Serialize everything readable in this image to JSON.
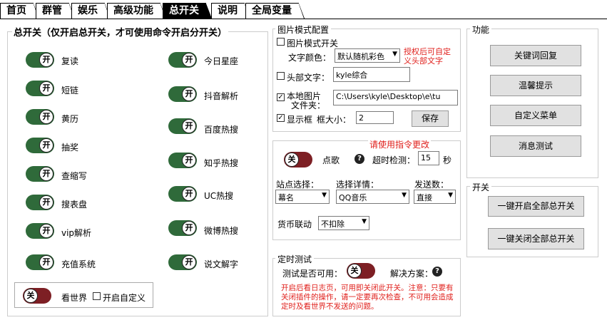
{
  "tabs": [
    "首页",
    "群管",
    "娱乐",
    "高级功能",
    "总开关",
    "说明",
    "全局变量"
  ],
  "master": {
    "title": "总开关（仅开启总开关，才可使用命令开启分开关）",
    "left_items": [
      "复读",
      "短链",
      "黄历",
      "抽奖",
      "查缩写",
      "搜表盘",
      "vip解析",
      "充值系统"
    ],
    "right_items": [
      "今日星座",
      "抖音解析",
      "百度热搜",
      "知乎热搜",
      "UC热搜",
      "微博热搜",
      "说文解字"
    ],
    "on_text": "开",
    "off_text": "关",
    "world_label": "看世界",
    "world_custom_label": "开启自定义"
  },
  "image_mode": {
    "title": "图片模式配置",
    "switch_label": "图片模式开关",
    "font_color_label": "文字颜色：",
    "font_color_value": "默认随机彩色",
    "note": "授权后可自定义头部文字",
    "header_text_label": "头部文字：",
    "header_text_value": "kyle综合",
    "local_image_label_1": "本地图片",
    "local_image_label_2": "文件夹：",
    "local_image_path": "C:\\Users\\kyle\\Desktop\\e\\tu",
    "show_frame_label": "显示框",
    "frame_size_label": "框大小：",
    "frame_size_value": "2",
    "save_label": "保存"
  },
  "song": {
    "note": "请使用指令更改",
    "label": "点歌",
    "timeout_label": "超时检测：",
    "timeout_value": "15",
    "timeout_unit": "秒",
    "site_label": "站点选择：",
    "site_value": "幕名",
    "detail_label": "选择详情：",
    "detail_value": "QQ音乐",
    "send_label": "发送数：",
    "send_value": "直接",
    "currency_label": "货币联动",
    "currency_value": "不扣除"
  },
  "timer": {
    "title": "定时测试",
    "test_label": "测试是否可用：",
    "solution_label": "解决方案：",
    "warning": "开启后看日志页，可用即关闭此开关。注意：只要有关闭插件的操作，请一定要再次检查，不可用会造成定时及看世界不发送的问题。"
  },
  "functions": {
    "title": "功能",
    "buttons": [
      "关键词回复",
      "温馨提示",
      "自定义菜单",
      "消息测试"
    ]
  },
  "switches": {
    "title": "开关",
    "buttons": [
      "一键开启全部总开关",
      "一键关闭全部总开关"
    ]
  }
}
